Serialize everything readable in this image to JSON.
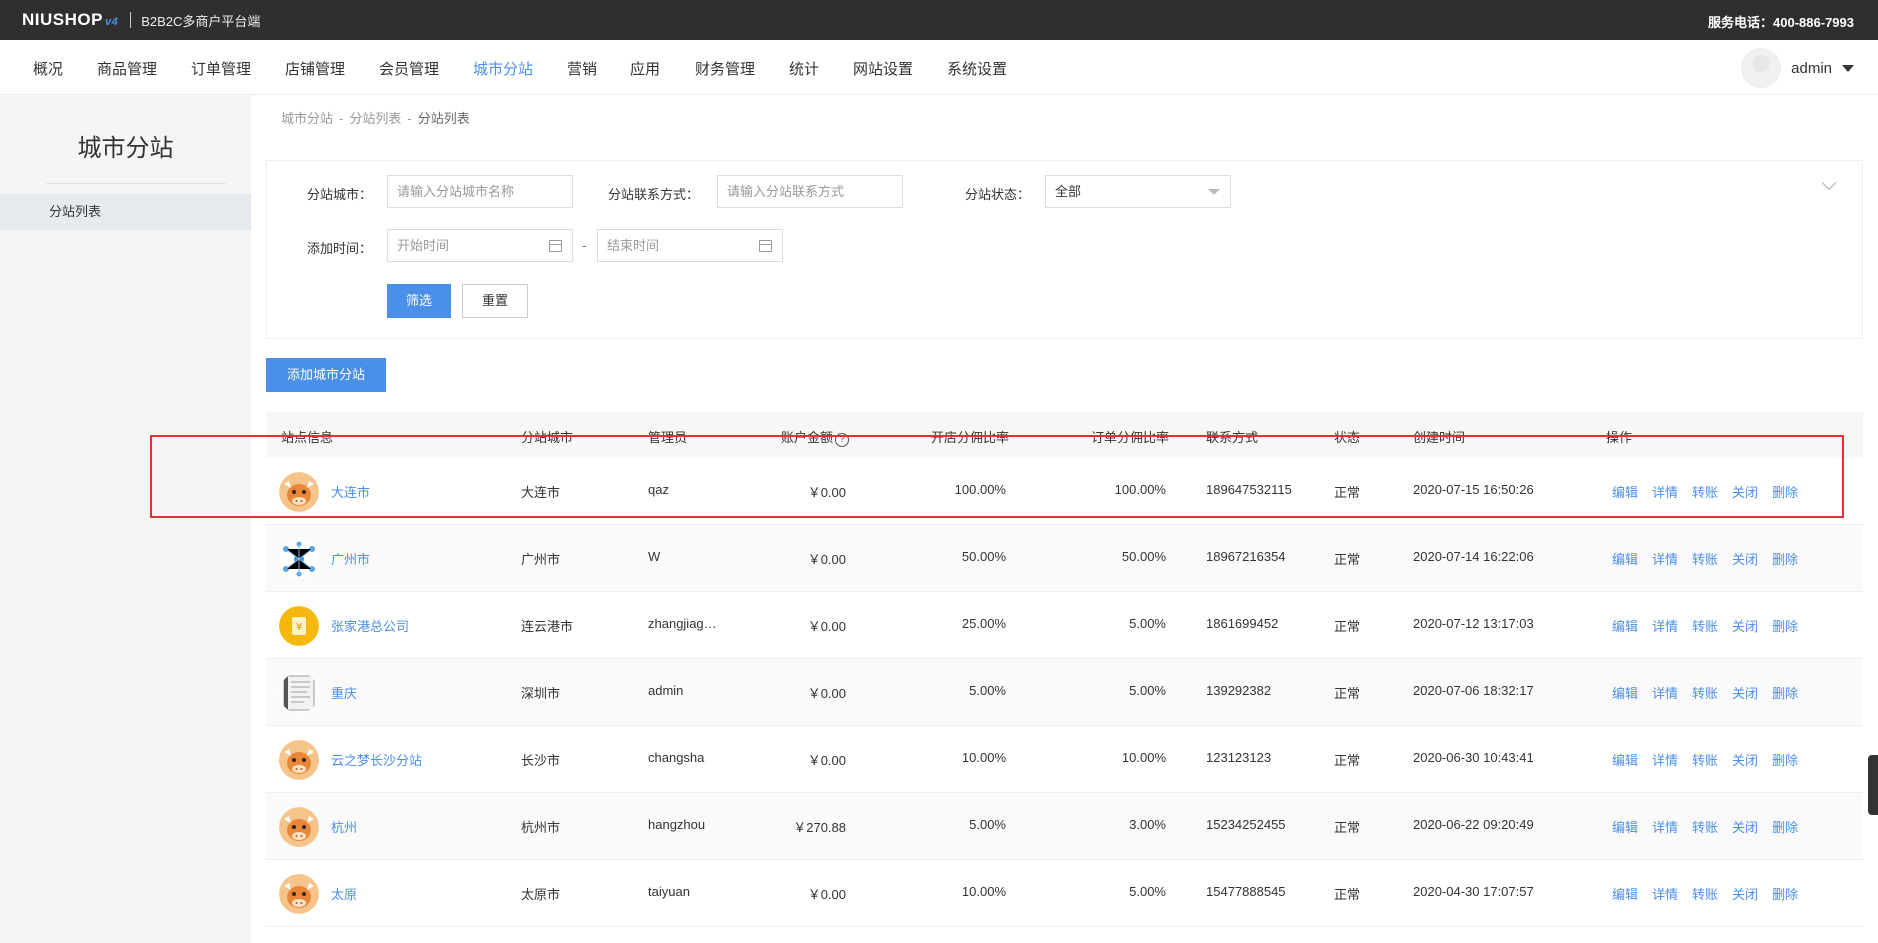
{
  "header": {
    "logo": "NIUSHOP",
    "logo_version": "v4",
    "platform": "B2B2C多商户平台端",
    "service_phone": "服务电话：400-886-7993"
  },
  "nav": {
    "items": [
      "概况",
      "商品管理",
      "订单管理",
      "店铺管理",
      "会员管理",
      "城市分站",
      "营销",
      "应用",
      "财务管理",
      "统计",
      "网站设置",
      "系统设置"
    ],
    "active": "城市分站",
    "user": "admin"
  },
  "sidebar": {
    "title": "城市分站",
    "items": [
      "分站列表"
    ]
  },
  "breadcrumb": [
    "城市分站",
    "分站列表",
    "分站列表"
  ],
  "filter": {
    "city_label": "分站城市：",
    "city_placeholder": "请输入分站城市名称",
    "contact_label": "分站联系方式：",
    "contact_placeholder": "请输入分站联系方式",
    "status_label": "分站状态：",
    "status_value": "全部",
    "time_label": "添加时间：",
    "start_placeholder": "开始时间",
    "end_placeholder": "结束时间",
    "range_sep": "-",
    "filter_button": "筛选",
    "reset_button": "重置"
  },
  "add_button": "添加城市分站",
  "table": {
    "headers": [
      "站点信息",
      "分站城市",
      "管理员",
      "账户金额",
      "开店分佣比率",
      "订单分佣比率",
      "联系方式",
      "状态",
      "创建时间",
      "操作"
    ],
    "help_icon": "?",
    "ops": [
      "编辑",
      "详情",
      "转账",
      "关闭",
      "删除"
    ],
    "rows": [
      {
        "name": "大连市",
        "city": "大连市",
        "admin": "qaz",
        "amount": "￥0.00",
        "shop_rate": "100.00%",
        "order_rate": "100.00%",
        "contact": "189647532115",
        "status": "正常",
        "created": "2020-07-15 16:50:26",
        "icon": "bull-mascot"
      },
      {
        "name": "广州市",
        "city": "广州市",
        "admin": "W",
        "amount": "￥0.00",
        "shop_rate": "50.00%",
        "order_rate": "50.00%",
        "contact": "18967216354",
        "status": "正常",
        "created": "2020-07-14 16:22:06",
        "icon": "network"
      },
      {
        "name": "张家港总公司",
        "city": "连云港市",
        "admin": "zhangjiag…",
        "amount": "￥0.00",
        "shop_rate": "25.00%",
        "order_rate": "5.00%",
        "contact": "1861699452",
        "status": "正常",
        "created": "2020-07-12 13:17:03",
        "icon": "coin"
      },
      {
        "name": "重庆",
        "city": "深圳市",
        "admin": "admin",
        "amount": "￥0.00",
        "shop_rate": "5.00%",
        "order_rate": "5.00%",
        "contact": "139292382",
        "status": "正常",
        "created": "2020-07-06 18:32:17",
        "icon": "document"
      },
      {
        "name": "云之梦长沙分站",
        "city": "长沙市",
        "admin": "changsha",
        "amount": "￥0.00",
        "shop_rate": "10.00%",
        "order_rate": "10.00%",
        "contact": "123123123",
        "status": "正常",
        "created": "2020-06-30 10:43:41",
        "icon": "bull-mascot"
      },
      {
        "name": "杭州",
        "city": "杭州市",
        "admin": "hangzhou",
        "amount": "￥270.88",
        "shop_rate": "5.00%",
        "order_rate": "3.00%",
        "contact": "15234252455",
        "status": "正常",
        "created": "2020-06-22 09:20:49",
        "icon": "bull-mascot"
      },
      {
        "name": "太原",
        "city": "太原市",
        "admin": "taiyuan",
        "amount": "￥0.00",
        "shop_rate": "10.00%",
        "order_rate": "5.00%",
        "contact": "15477888545",
        "status": "正常",
        "created": "2020-04-30 17:07:57",
        "icon": "bull-mascot"
      }
    ]
  },
  "colors": {
    "primary": "#4a8fe8",
    "topbar": "#2f2f2f",
    "highlight": "#e8302f"
  }
}
